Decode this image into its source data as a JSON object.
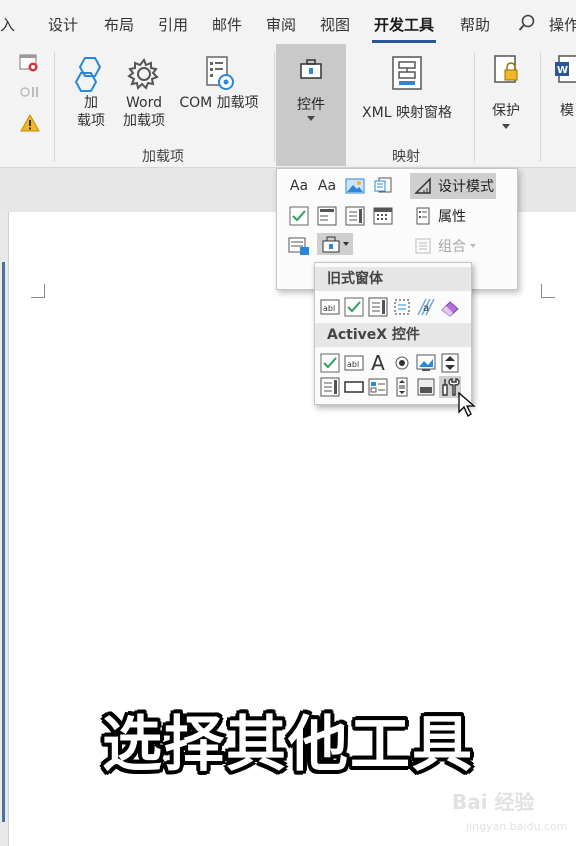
{
  "tabs": [
    {
      "label": "插入",
      "visible": "入"
    },
    {
      "label": "设计"
    },
    {
      "label": "布局"
    },
    {
      "label": "引用"
    },
    {
      "label": "邮件"
    },
    {
      "label": "审阅"
    },
    {
      "label": "视图"
    },
    {
      "label": "开发工具",
      "active": true
    },
    {
      "label": "帮助"
    },
    {
      "label": "操作",
      "visible": "操作"
    }
  ],
  "ribbon": {
    "addins_group": {
      "label": "加载项",
      "buttons": [
        {
          "line1": "加",
          "line2": "载项"
        },
        {
          "line1": "Word",
          "line2": "加载项"
        },
        {
          "line1": "COM 加载项",
          "line2": ""
        }
      ]
    },
    "controls_button": {
      "label": "控件"
    },
    "mapping_group": {
      "label": "映射",
      "buttons": [
        {
          "label": "XML 映射窗格"
        }
      ]
    },
    "protect_button": {
      "label": "保护"
    },
    "template_button": {
      "label": "模"
    }
  },
  "controls_menu": {
    "row1": [
      "Aa",
      "Aa"
    ],
    "items": [
      {
        "label": "设计模式",
        "state": "active"
      },
      {
        "label": "属性"
      },
      {
        "label": "组合",
        "state": "disabled"
      }
    ]
  },
  "submenu": {
    "legacy_header": "旧式窗体",
    "activex_header": "ActiveX 控件",
    "text_icon_glyph": "A",
    "abl_glyph": "abl"
  },
  "caption": "选择其他工具",
  "watermark": {
    "brand": "Bai 经验",
    "url": "jingyan.baidu.com"
  },
  "colors": {
    "ribbon_bg": "#f3f3f3",
    "accent": "#2b579a",
    "check_green": "#2e9e5e",
    "highlight": "#cfcfcf"
  }
}
